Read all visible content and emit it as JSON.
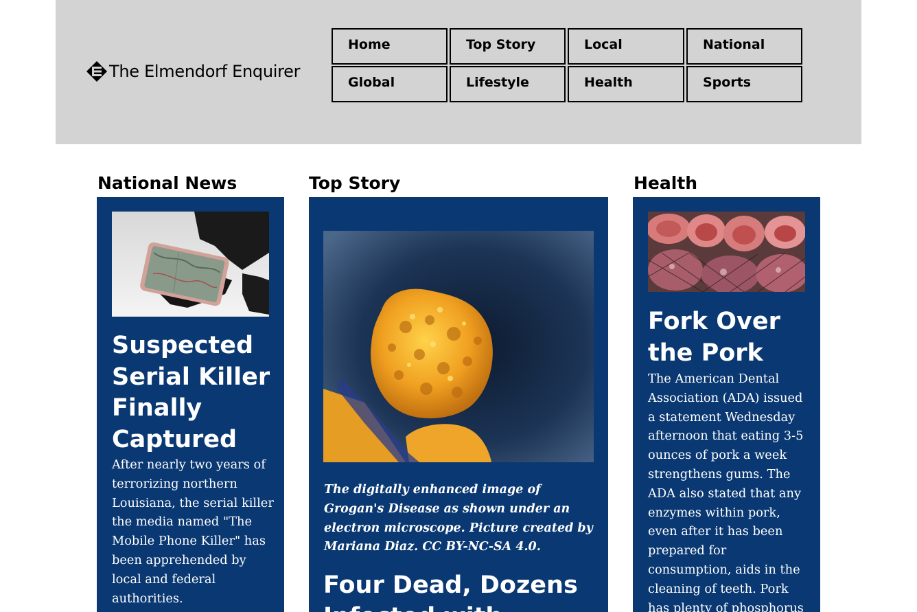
{
  "site": {
    "title": "The Elmendorf Enquirer",
    "logo_icon": "diamond-e-logo-icon"
  },
  "nav": {
    "items": [
      {
        "label": "Home"
      },
      {
        "label": "Top Story"
      },
      {
        "label": "Local"
      },
      {
        "label": "National"
      },
      {
        "label": "Global"
      },
      {
        "label": "Lifestyle"
      },
      {
        "label": "Health"
      },
      {
        "label": "Sports"
      }
    ]
  },
  "sections": {
    "national": {
      "title": "National News",
      "image": "hand-holding-phone-image",
      "headline": "Suspected Serial Killer Finally Captured",
      "body": "After nearly two years of terrorizing northern Louisiana, the serial killer the media named \"The Mobile Phone Killer\" has been apprehended by local and federal authorities."
    },
    "top": {
      "title": "Top Story",
      "image": "microscope-disease-image",
      "caption": "The digitally enhanced image of Grogan's Disease as shown under an electron microscope. Picture created by Mariana Diaz. CC BY-NC-SA 4.0.",
      "headline": "Four Dead, Dozens Infected with"
    },
    "health": {
      "title": "Health",
      "image": "pork-meat-image",
      "headline": "Fork Over the Pork",
      "body": "The American Dental Association (ADA) issued a statement Wednesday afternoon that eating 3-5 ounces of pork a week strengthens gums. The ADA also stated that any enzymes within pork, even after it has been prepared for consumption, aids in the cleaning of teeth. Pork has plenty of phosphorus"
    }
  },
  "colors": {
    "header_bg": "#d3d3d3",
    "card_bg": "#0a3872",
    "text_on_card": "#ffffff"
  }
}
